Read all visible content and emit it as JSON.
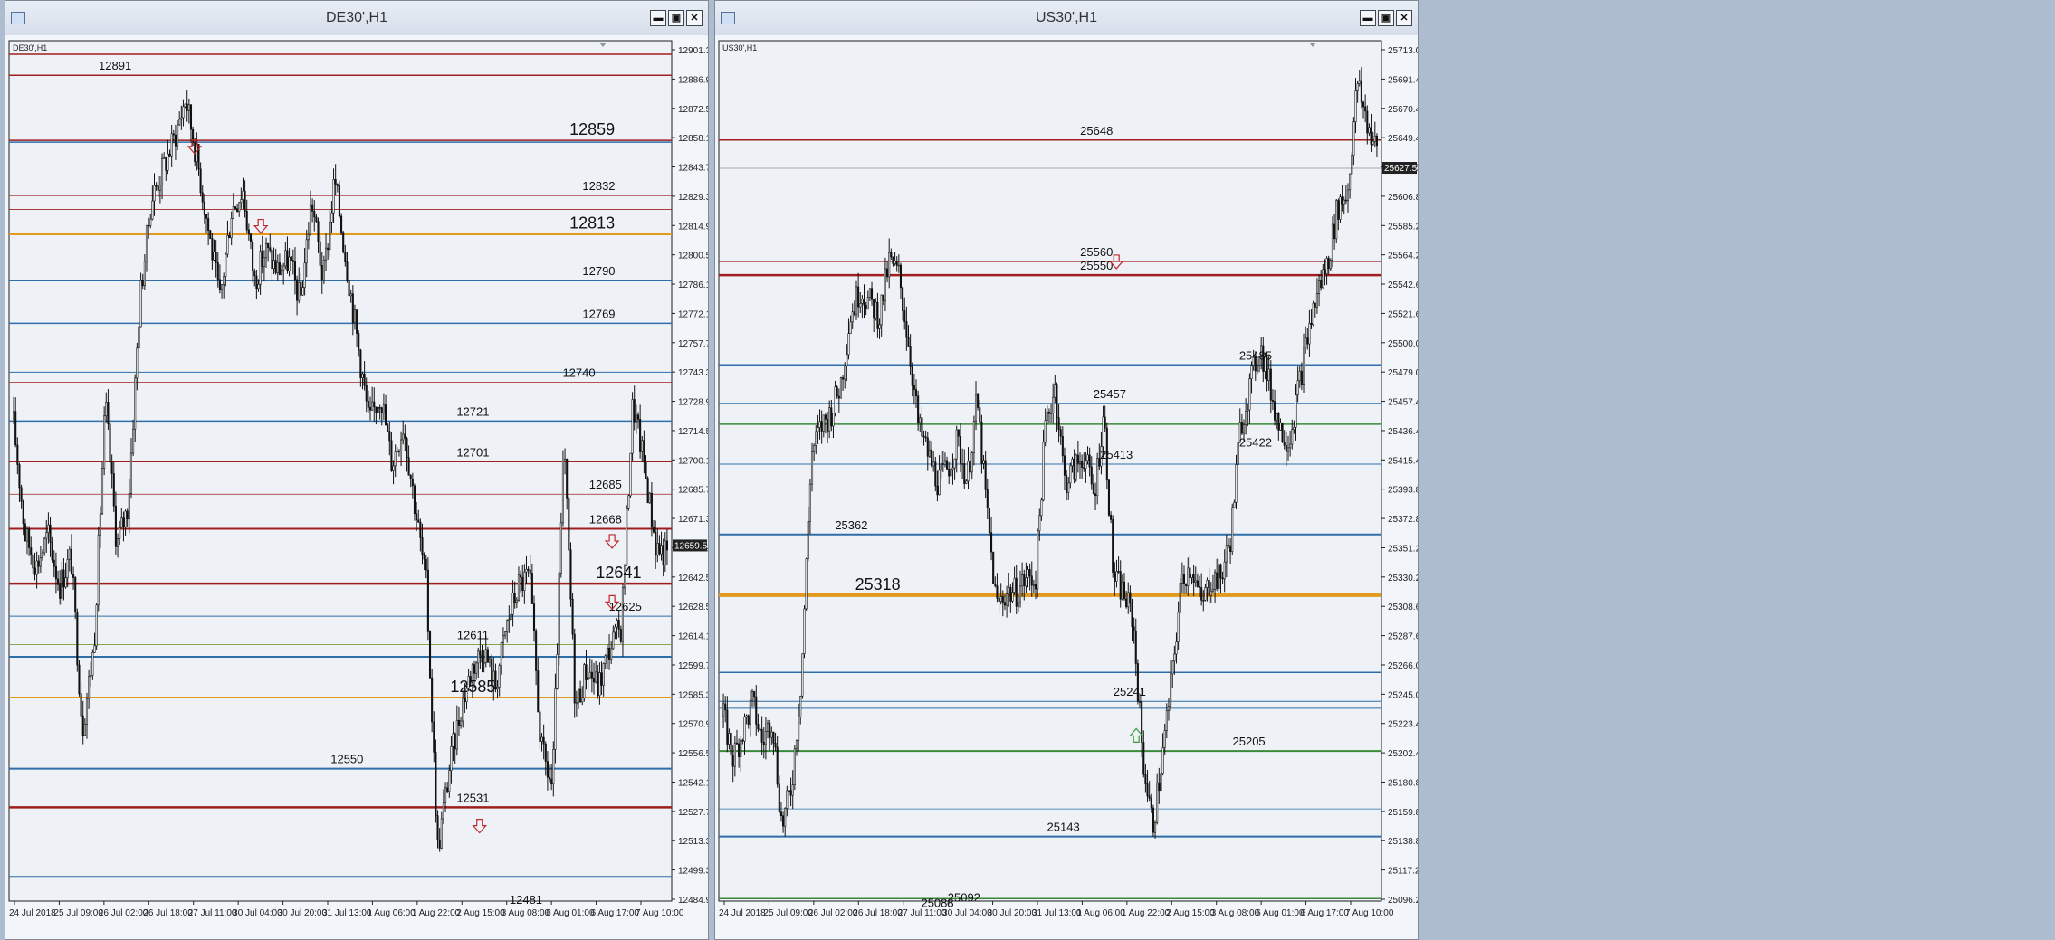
{
  "windows": [
    {
      "key": "de30",
      "title": "DE30',H1",
      "symbol_label": "DE30',H1",
      "buttons": [
        "minimize-button",
        "maximize-button",
        "close-button"
      ],
      "chart_data": {
        "type": "candlestick",
        "symbol": "DE30'",
        "timeframe": "H1",
        "ylim": [
          12484.9,
          12908.0
        ],
        "y_ticks": [
          "12901.30",
          "12886.90",
          "12872.50",
          "12858.10",
          "12843.70",
          "12829.30",
          "12814.90",
          "12800.50",
          "12786.10",
          "12772.10",
          "12757.70",
          "12743.30",
          "12728.90",
          "12714.50",
          "12700.10",
          "12685.70",
          "12671.30",
          "12656.90",
          "12642.50",
          "12628.50",
          "12614.10",
          "12599.70",
          "12585.30",
          "12570.90",
          "12556.50",
          "12542.10",
          "12527.70",
          "12513.30",
          "12499.30",
          "12484.90"
        ],
        "x_ticks": [
          "24 Jul 2018",
          "25 Jul 09:00",
          "26 Jul 02:00",
          "26 Jul 18:00",
          "27 Jul 11:00",
          "30 Jul 04:00",
          "30 Jul 20:00",
          "31 Jul 13:00",
          "1 Aug 06:00",
          "1 Aug 22:00",
          "2 Aug 15:00",
          "3 Aug 08:00",
          "6 Aug 01:00",
          "6 Aug 17:00",
          "7 Aug 10:00"
        ],
        "current_price_label": "12659.55",
        "current_price": 12659.55,
        "levels": [
          {
            "price": 12901.3,
            "color": "#a01e1e",
            "width": 1.5
          },
          {
            "price": 12891,
            "color": "#a01e1e",
            "width": 1.5
          },
          {
            "price": 12859,
            "color": "#a01e1e",
            "width": 1.5
          },
          {
            "price": 12858.1,
            "color": "#2f6ea8",
            "width": 1.5
          },
          {
            "price": 12832,
            "color": "#a01e1e",
            "width": 1.5
          },
          {
            "price": 12825,
            "color": "#a01e1e",
            "width": 0.8
          },
          {
            "price": 12813,
            "color": "#e39a1a",
            "width": 3
          },
          {
            "price": 12790,
            "color": "#2f6ea8",
            "width": 1.5
          },
          {
            "price": 12769,
            "color": "#2f6ea8",
            "width": 1.5
          },
          {
            "price": 12745,
            "color": "#2f6ea8",
            "width": 1
          },
          {
            "price": 12740,
            "color": "#a01e1e",
            "width": 0.8
          },
          {
            "price": 12721,
            "color": "#2f6ea8",
            "width": 1.5
          },
          {
            "price": 12701,
            "color": "#a01e1e",
            "width": 1.5
          },
          {
            "price": 12685,
            "color": "#a01e1e",
            "width": 0.8
          },
          {
            "price": 12668,
            "color": "#a01e1e",
            "width": 2
          },
          {
            "price": 12641,
            "color": "#a01e1e",
            "width": 2.5
          },
          {
            "price": 12625,
            "color": "#2f6ea8",
            "width": 1
          },
          {
            "price": 12611,
            "color": "#7a9a3a",
            "width": 0.8
          },
          {
            "price": 12605,
            "color": "#2f6ea8",
            "width": 2
          },
          {
            "price": 12585,
            "color": "#e39a1a",
            "width": 2
          },
          {
            "price": 12550,
            "color": "#2f6ea8",
            "width": 2
          },
          {
            "price": 12531,
            "color": "#a01e1e",
            "width": 2.5
          },
          {
            "price": 12497,
            "color": "#2f6ea8",
            "width": 1
          }
        ],
        "labels": [
          {
            "text": "12891",
            "price": 12891,
            "pos": 0.16,
            "big": false
          },
          {
            "text": "12859",
            "price": 12859,
            "pos": 0.88,
            "big": true
          },
          {
            "text": "12832",
            "price": 12832,
            "pos": 0.89,
            "big": false
          },
          {
            "text": "12813",
            "price": 12813,
            "pos": 0.88,
            "big": true
          },
          {
            "text": "12790",
            "price": 12790,
            "pos": 0.89,
            "big": false
          },
          {
            "text": "12769",
            "price": 12769,
            "pos": 0.89,
            "big": false
          },
          {
            "text": "12740",
            "price": 12740,
            "pos": 0.86,
            "big": false
          },
          {
            "text": "12721",
            "price": 12721,
            "pos": 0.7,
            "big": false
          },
          {
            "text": "12701",
            "price": 12701,
            "pos": 0.7,
            "big": false
          },
          {
            "text": "12685",
            "price": 12685,
            "pos": 0.9,
            "big": false
          },
          {
            "text": "12668",
            "price": 12668,
            "pos": 0.9,
            "big": false
          },
          {
            "text": "12641",
            "price": 12641,
            "pos": 0.92,
            "big": true
          },
          {
            "text": "12625",
            "price": 12625,
            "pos": 0.93,
            "big": false
          },
          {
            "text": "12611",
            "price": 12611,
            "pos": 0.7,
            "big": false
          },
          {
            "text": "12585",
            "price": 12585,
            "pos": 0.7,
            "big": true
          },
          {
            "text": "12550",
            "price": 12550,
            "pos": 0.51,
            "big": false
          },
          {
            "text": "12531",
            "price": 12531,
            "pos": 0.7,
            "big": false
          },
          {
            "text": "12481",
            "price": 12481,
            "pos": 0.78,
            "big": false
          }
        ],
        "arrows": [
          {
            "dir": "down",
            "color": "#c0282d",
            "price": 12856,
            "pos": 0.28
          },
          {
            "dir": "down",
            "color": "#c0282d",
            "price": 12817,
            "pos": 0.38
          },
          {
            "dir": "down",
            "color": "#c0282d",
            "price": 12662,
            "pos": 0.91
          },
          {
            "dir": "down",
            "color": "#c0282d",
            "price": 12632,
            "pos": 0.91
          },
          {
            "dir": "down",
            "color": "#c0282d",
            "price": 12522,
            "pos": 0.71
          }
        ],
        "price_path": [
          12720,
          12665,
          12650,
          12665,
          12640,
          12655,
          12570,
          12610,
          12730,
          12660,
          12680,
          12780,
          12830,
          12845,
          12860,
          12880,
          12850,
          12815,
          12780,
          12825,
          12835,
          12790,
          12805,
          12795,
          12800,
          12780,
          12830,
          12790,
          12840,
          12800,
          12760,
          12720,
          12735,
          12700,
          12720,
          12680,
          12640,
          12510,
          12550,
          12580,
          12600,
          12610,
          12590,
          12620,
          12640,
          12645,
          12560,
          12540,
          12710,
          12580,
          12600,
          12590,
          12610,
          12620,
          12730,
          12700,
          12660,
          12655
        ]
      }
    },
    {
      "key": "us30",
      "title": "US30',H1",
      "symbol_label": "US30',H1",
      "buttons": [
        "minimize-button",
        "maximize-button",
        "close-button"
      ],
      "chart_data": {
        "type": "candlestick",
        "symbol": "US30'",
        "timeframe": "H1",
        "ylim": [
          25096.2,
          25720.0
        ],
        "y_ticks": [
          "25713.00",
          "25691.40",
          "25670.40",
          "25649.40",
          "25627.50",
          "25606.80",
          "25585.20",
          "25564.20",
          "25542.60",
          "25521.60",
          "25500.00",
          "25479.00",
          "25457.40",
          "25436.40",
          "25415.40",
          "25393.80",
          "25372.80",
          "25351.20",
          "25330.20",
          "25308.60",
          "25287.60",
          "25266.00",
          "25245.00",
          "25223.40",
          "25202.40",
          "25180.80",
          "25159.80",
          "25138.80",
          "25117.20",
          "25096.20"
        ],
        "x_ticks": [
          "24 Jul 2018",
          "25 Jul 09:00",
          "26 Jul 02:00",
          "26 Jul 18:00",
          "27 Jul 11:00",
          "30 Jul 04:00",
          "30 Jul 20:00",
          "31 Jul 13:00",
          "1 Aug 06:00",
          "1 Aug 22:00",
          "2 Aug 15:00",
          "3 Aug 08:00",
          "6 Aug 01:00",
          "6 Aug 17:00",
          "7 Aug 10:00"
        ],
        "current_price_label": "25627.50",
        "current_price": 25627.5,
        "levels": [
          {
            "price": 25648,
            "color": "#a01e1e",
            "width": 1.5
          },
          {
            "price": 25627.5,
            "color": "#8a8f96",
            "width": 0.8
          },
          {
            "price": 25560,
            "color": "#a01e1e",
            "width": 1.5
          },
          {
            "price": 25550,
            "color": "#a01e1e",
            "width": 2.5
          },
          {
            "price": 25485,
            "color": "#2f6ea8",
            "width": 1.5
          },
          {
            "price": 25457,
            "color": "#2f6ea8",
            "width": 1.5
          },
          {
            "price": 25442,
            "color": "#3a8a3a",
            "width": 1.5
          },
          {
            "price": 25413,
            "color": "#2f6ea8",
            "width": 1
          },
          {
            "price": 25362,
            "color": "#2f6ea8",
            "width": 2
          },
          {
            "price": 25318,
            "color": "#e39a1a",
            "width": 4
          },
          {
            "price": 25262,
            "color": "#2f6ea8",
            "width": 1.5
          },
          {
            "price": 25241,
            "color": "#2f6ea8",
            "width": 1
          },
          {
            "price": 25236,
            "color": "#2f6ea8",
            "width": 1
          },
          {
            "price": 25205,
            "color": "#3a8a3a",
            "width": 2
          },
          {
            "price": 25163,
            "color": "#2f6ea8",
            "width": 0.8
          },
          {
            "price": 25143,
            "color": "#2f6ea8",
            "width": 2
          },
          {
            "price": 25098,
            "color": "#3a8a3a",
            "width": 1.5
          }
        ],
        "labels": [
          {
            "text": "25648",
            "price": 25648,
            "pos": 0.57,
            "big": false
          },
          {
            "text": "25560",
            "price": 25560,
            "pos": 0.57,
            "big": false
          },
          {
            "text": "25550",
            "price": 25550,
            "pos": 0.57,
            "big": false
          },
          {
            "text": "25485",
            "price": 25485,
            "pos": 0.81,
            "big": false
          },
          {
            "text": "25457",
            "price": 25457,
            "pos": 0.59,
            "big": false
          },
          {
            "text": "25422",
            "price": 25422,
            "pos": 0.81,
            "big": false
          },
          {
            "text": "25413",
            "price": 25413,
            "pos": 0.6,
            "big": false
          },
          {
            "text": "25362",
            "price": 25362,
            "pos": 0.2,
            "big": false
          },
          {
            "text": "25318",
            "price": 25318,
            "pos": 0.24,
            "big": true
          },
          {
            "text": "25241",
            "price": 25241,
            "pos": 0.62,
            "big": false
          },
          {
            "text": "25205",
            "price": 25205,
            "pos": 0.8,
            "big": false
          },
          {
            "text": "25143",
            "price": 25143,
            "pos": 0.52,
            "big": false
          },
          {
            "text": "25092",
            "price": 25092,
            "pos": 0.37,
            "big": false
          },
          {
            "text": "25088",
            "price": 25088,
            "pos": 0.33,
            "big": false
          }
        ],
        "arrows": [
          {
            "dir": "down",
            "color": "#c0282d",
            "price": 25560,
            "pos": 0.6
          },
          {
            "dir": "up",
            "color": "#3a9a3a",
            "price": 25216,
            "pos": 0.63
          }
        ],
        "price_path": [
          25230,
          25200,
          25220,
          25240,
          25210,
          25230,
          25150,
          25180,
          25260,
          25420,
          25440,
          25450,
          25470,
          25520,
          25540,
          25530,
          25520,
          25560,
          25550,
          25500,
          25440,
          25420,
          25400,
          25410,
          25430,
          25400,
          25460,
          25380,
          25310,
          25320,
          25320,
          25330,
          25330,
          25440,
          25470,
          25400,
          25410,
          25420,
          25390,
          25450,
          25330,
          25320,
          25300,
          25200,
          25150,
          25200,
          25260,
          25330,
          25340,
          25310,
          25330,
          25330,
          25360,
          25440,
          25470,
          25500,
          25470,
          25440,
          25430,
          25470,
          25510,
          25540,
          25560,
          25600,
          25610,
          25690,
          25660,
          25640
        ]
      }
    }
  ]
}
